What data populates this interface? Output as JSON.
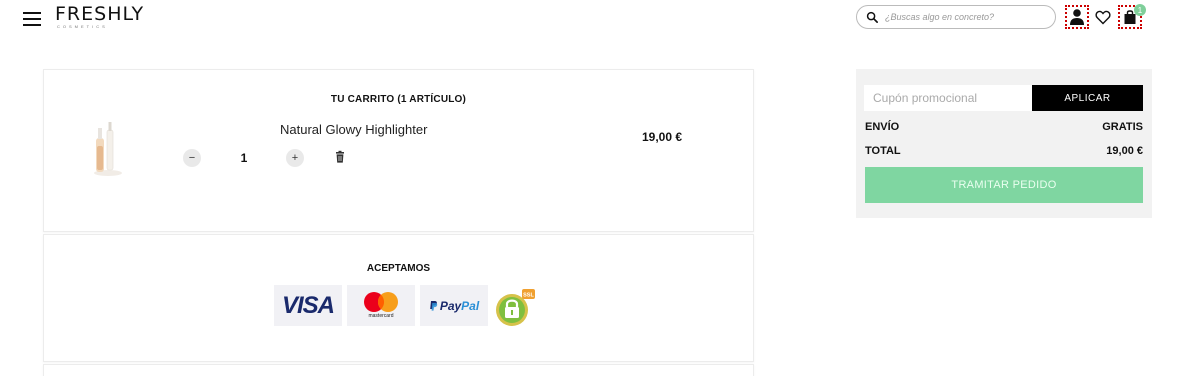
{
  "header": {
    "logo_text": "FRESHLY",
    "logo_sub": "COSMETICS",
    "search_placeholder": "¿Buscas algo en concreto?",
    "cart_count": "1"
  },
  "cart": {
    "title": "TU CARRITO (1 ARTÍCULO)",
    "item": {
      "name": "Natural Glowy Highlighter",
      "quantity": "1",
      "price": "19,00 €",
      "minus_label": "−",
      "plus_label": "+"
    }
  },
  "payments": {
    "title": "ACEPTAMOS",
    "visa": "VISA",
    "mastercard": "mastercard",
    "paypal_a": "Pay",
    "paypal_b": "Pal",
    "ssl": "SSL"
  },
  "summary": {
    "coupon_placeholder": "Cupón promocional",
    "apply_label": "APLICAR",
    "shipping_label": "ENVÍO",
    "shipping_value": "GRATIS",
    "total_label": "TOTAL",
    "total_value": "19,00 €",
    "checkout_label": "TRAMITAR PEDIDO"
  },
  "colors": {
    "checkout": "#7fd6a1",
    "badge": "#7fcf9a",
    "visa": "#1a2a6c",
    "paypal_dark": "#1a2a6c",
    "paypal_light": "#2a8fd6"
  },
  "icons": [
    "menu-icon",
    "search-icon",
    "user-icon",
    "heart-icon",
    "shopping-bag-icon",
    "trash-icon",
    "ssl-lock-icon"
  ]
}
